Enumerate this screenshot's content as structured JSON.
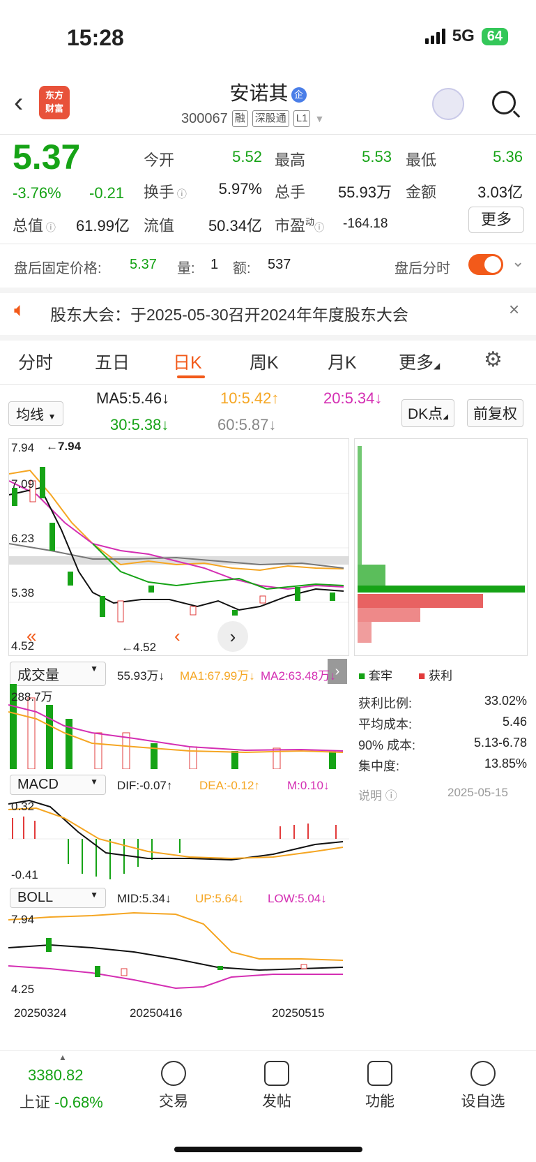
{
  "status": {
    "time": "15:28",
    "network": "5G",
    "battery": "64"
  },
  "header": {
    "logo_line1": "东方",
    "logo_line2": "财富",
    "stock_name": "安诺其",
    "qi_badge": "企",
    "code": "300067",
    "tags": [
      "融",
      "深股通",
      "L1"
    ]
  },
  "quote": {
    "price": "5.37",
    "pct": "-3.76%",
    "chg": "-0.21",
    "open_label": "今开",
    "open": "5.52",
    "high_label": "最高",
    "high": "5.53",
    "low_label": "最低",
    "low": "5.36",
    "turnover_label": "换手",
    "turnover": "5.97%",
    "volume_label": "总手",
    "volume": "55.93万",
    "amount_label": "金额",
    "amount": "3.03亿",
    "mcap_label": "总值",
    "mcap": "61.99亿",
    "float_label": "流值",
    "float": "50.34亿",
    "pe_label": "市盈",
    "pe_sup": "动",
    "pe": "-164.18",
    "more_label": "更多"
  },
  "after_hours": {
    "label": "盘后固定价格:",
    "price": "5.37",
    "vol_label": "量:",
    "vol": "1",
    "amt_label": "额:",
    "amt": "537",
    "timeline_label": "盘后分时"
  },
  "notice": {
    "text": "股东大会：于2025-05-30召开2024年年度股东大会"
  },
  "tabs": [
    "分时",
    "五日",
    "日K",
    "周K",
    "月K",
    "更多"
  ],
  "ma": {
    "select": "均线",
    "ma5": "MA5:5.46↓",
    "ma10": "10:5.42↑",
    "ma20": "20:5.34↓",
    "ma30": "30:5.38↓",
    "ma60": "60:5.87↓",
    "dk": "DK点",
    "adjust": "前复权"
  },
  "kline": {
    "y_top": "7.94",
    "y2": "7.09",
    "y3": "6.23",
    "y4": "5.38",
    "y_bottom": "4.52",
    "high_mark": "←7.94",
    "low_mark": "←4.52"
  },
  "volume": {
    "select": "成交量",
    "v": "55.93万↓",
    "ma1": "MA1:67.99万↓",
    "ma2": "MA2:63.48万↓",
    "y_top": "288.7万"
  },
  "macd": {
    "select": "MACD",
    "dif": "DIF:-0.07↑",
    "dea": "DEA:-0.12↑",
    "m": "M:0.10↓",
    "y_top": "0.32",
    "y_bottom": "-0.41"
  },
  "boll": {
    "select": "BOLL",
    "mid": "MID:5.34↓",
    "up": "UP:5.64↓",
    "low": "LOW:5.04↓",
    "y_top": "7.94",
    "y_bottom": "4.25"
  },
  "dates": [
    "20250324",
    "20250416",
    "20250515"
  ],
  "chips": {
    "legend_trap": "套牢",
    "legend_profit": "获利",
    "stats": [
      {
        "label": "获利比例:",
        "value": "33.02%"
      },
      {
        "label": "平均成本:",
        "value": "5.46"
      },
      {
        "label": "90% 成本:",
        "value": "5.13-6.78"
      },
      {
        "label": "集中度:",
        "value": "13.85%"
      }
    ],
    "note": "说明",
    "date": "2025-05-15"
  },
  "bottom": {
    "index_value": "3380.82",
    "index_name": "上证",
    "index_pct": "-0.68%",
    "nav": [
      "交易",
      "发帖",
      "功能",
      "设自选"
    ]
  }
}
